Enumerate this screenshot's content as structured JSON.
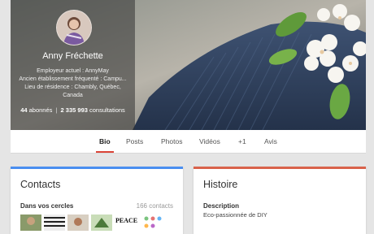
{
  "profile": {
    "name": "Anny Fréchette",
    "details": [
      "Employeur actuel : AnnyMay",
      "Ancien établissement fréquenté : Campu...",
      "Lieu de résidence : Chambly, Québec,",
      "Canada"
    ],
    "followers_count": "44",
    "followers_label": "abonnés",
    "views_count": "2 335 993",
    "views_label": "consultations"
  },
  "tabs": [
    {
      "label": "Bio",
      "active": true
    },
    {
      "label": "Posts"
    },
    {
      "label": "Photos"
    },
    {
      "label": "Vidéos"
    },
    {
      "label": "+1"
    },
    {
      "label": "Avis"
    }
  ],
  "contacts": {
    "title": "Contacts",
    "circles_label": "Dans vos cercles",
    "circles_count": "166 contacts",
    "thumb_text": "PEACE"
  },
  "story": {
    "title": "Histoire",
    "description_label": "Description",
    "description_text": "Eco-passionnée de DIY"
  },
  "colors": {
    "tab_active_underline": "#db4437",
    "contacts_accent": "#4a8ef0",
    "story_accent": "#d9624b"
  }
}
